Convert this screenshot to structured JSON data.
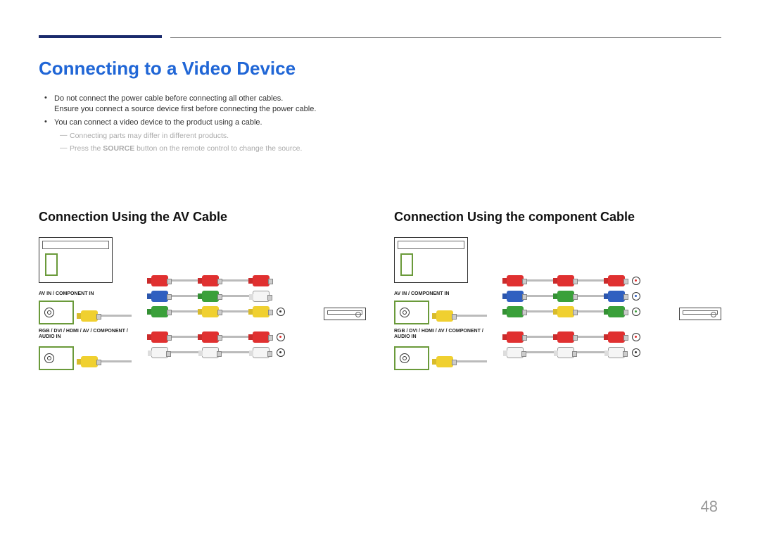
{
  "title": "Connecting to a Video Device",
  "bullets": {
    "b1_line1": "Do not connect the power cable before connecting all other cables.",
    "b1_line2": "Ensure you connect a source device first before connecting the power cable.",
    "b2": "You can connect a video device to the product using a cable."
  },
  "notes": {
    "n1": "Connecting parts may differ in different products.",
    "n2_pre": "Press the ",
    "n2_bold": "SOURCE",
    "n2_post": " button on the remote control to change the source."
  },
  "left": {
    "heading": "Connection Using the AV Cable",
    "label1": "AV IN / COMPONENT IN",
    "label2": "RGB / DVI / HDMI / AV / COMPONENT / AUDIO IN"
  },
  "right": {
    "heading": "Connection Using the component Cable",
    "label1": "AV IN / COMPONENT IN",
    "label2": "RGB / DVI / HDMI / AV / COMPONENT / AUDIO IN"
  },
  "page": "48"
}
